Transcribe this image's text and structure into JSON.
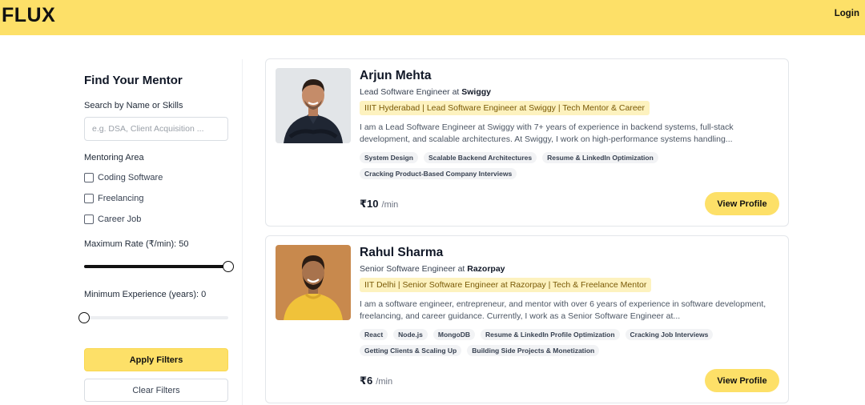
{
  "header": {
    "logo": "FLUX",
    "login_label": "Login",
    "bg_color": "#fde068"
  },
  "sidebar": {
    "title": "Find Your Mentor",
    "search_label": "Search by Name or Skills",
    "search_placeholder": "e.g. DSA, Client Acquisition ...",
    "search_value": "",
    "area_label": "Mentoring Area",
    "areas": [
      {
        "label": "Coding Software",
        "checked": false
      },
      {
        "label": "Freelancing",
        "checked": false
      },
      {
        "label": "Career Job",
        "checked": false
      }
    ],
    "rate_label": "Maximum Rate (₹/min): 50",
    "rate_value_fraction": 1.0,
    "experience_label": "Minimum Experience (years): 0",
    "experience_value_fraction": 0.0,
    "apply_label": "Apply Filters",
    "clear_label": "Clear Filters"
  },
  "mentors": [
    {
      "name": "Arjun Mehta",
      "role_prefix": "Lead Software Engineer at",
      "company": "Swiggy",
      "tagline": "IIIT Hyderabad | Lead Software Engineer at Swiggy | Tech Mentor & Career",
      "bio": "I am a Lead Software Engineer at Swiggy with 7+ years of experience in backend systems, full-stack development, and scalable architectures. At Swiggy, I work on high-performance systems handling...",
      "tags": [
        "System Design",
        "Scalable Backend Architectures",
        "Resume & LinkedIn Optimization",
        "Cracking Product-Based Company Interviews"
      ],
      "price": "₹10",
      "price_unit": "/min",
      "view_label": "View Profile",
      "photo_bg": "#e5e7ea"
    },
    {
      "name": "Rahul Sharma",
      "role_prefix": "Senior Software Engineer at",
      "company": "Razorpay",
      "tagline": "IIT Delhi | Senior Software Engineer at Razorpay | Tech & Freelance Mentor",
      "bio": "I am a software engineer, entrepreneur, and mentor with over 6 years of experience in software development, freelancing, and career guidance. Currently, I work as a Senior Software Engineer at...",
      "tags": [
        "React",
        "Node.js",
        "MongoDB",
        "Resume & LinkedIn Profile Optimization",
        "Cracking Job Interviews",
        "Getting Clients & Scaling Up",
        "Building Side Projects & Monetization"
      ],
      "price": "₹6",
      "price_unit": "/min",
      "view_label": "View Profile",
      "photo_bg": "#c8894d"
    }
  ]
}
